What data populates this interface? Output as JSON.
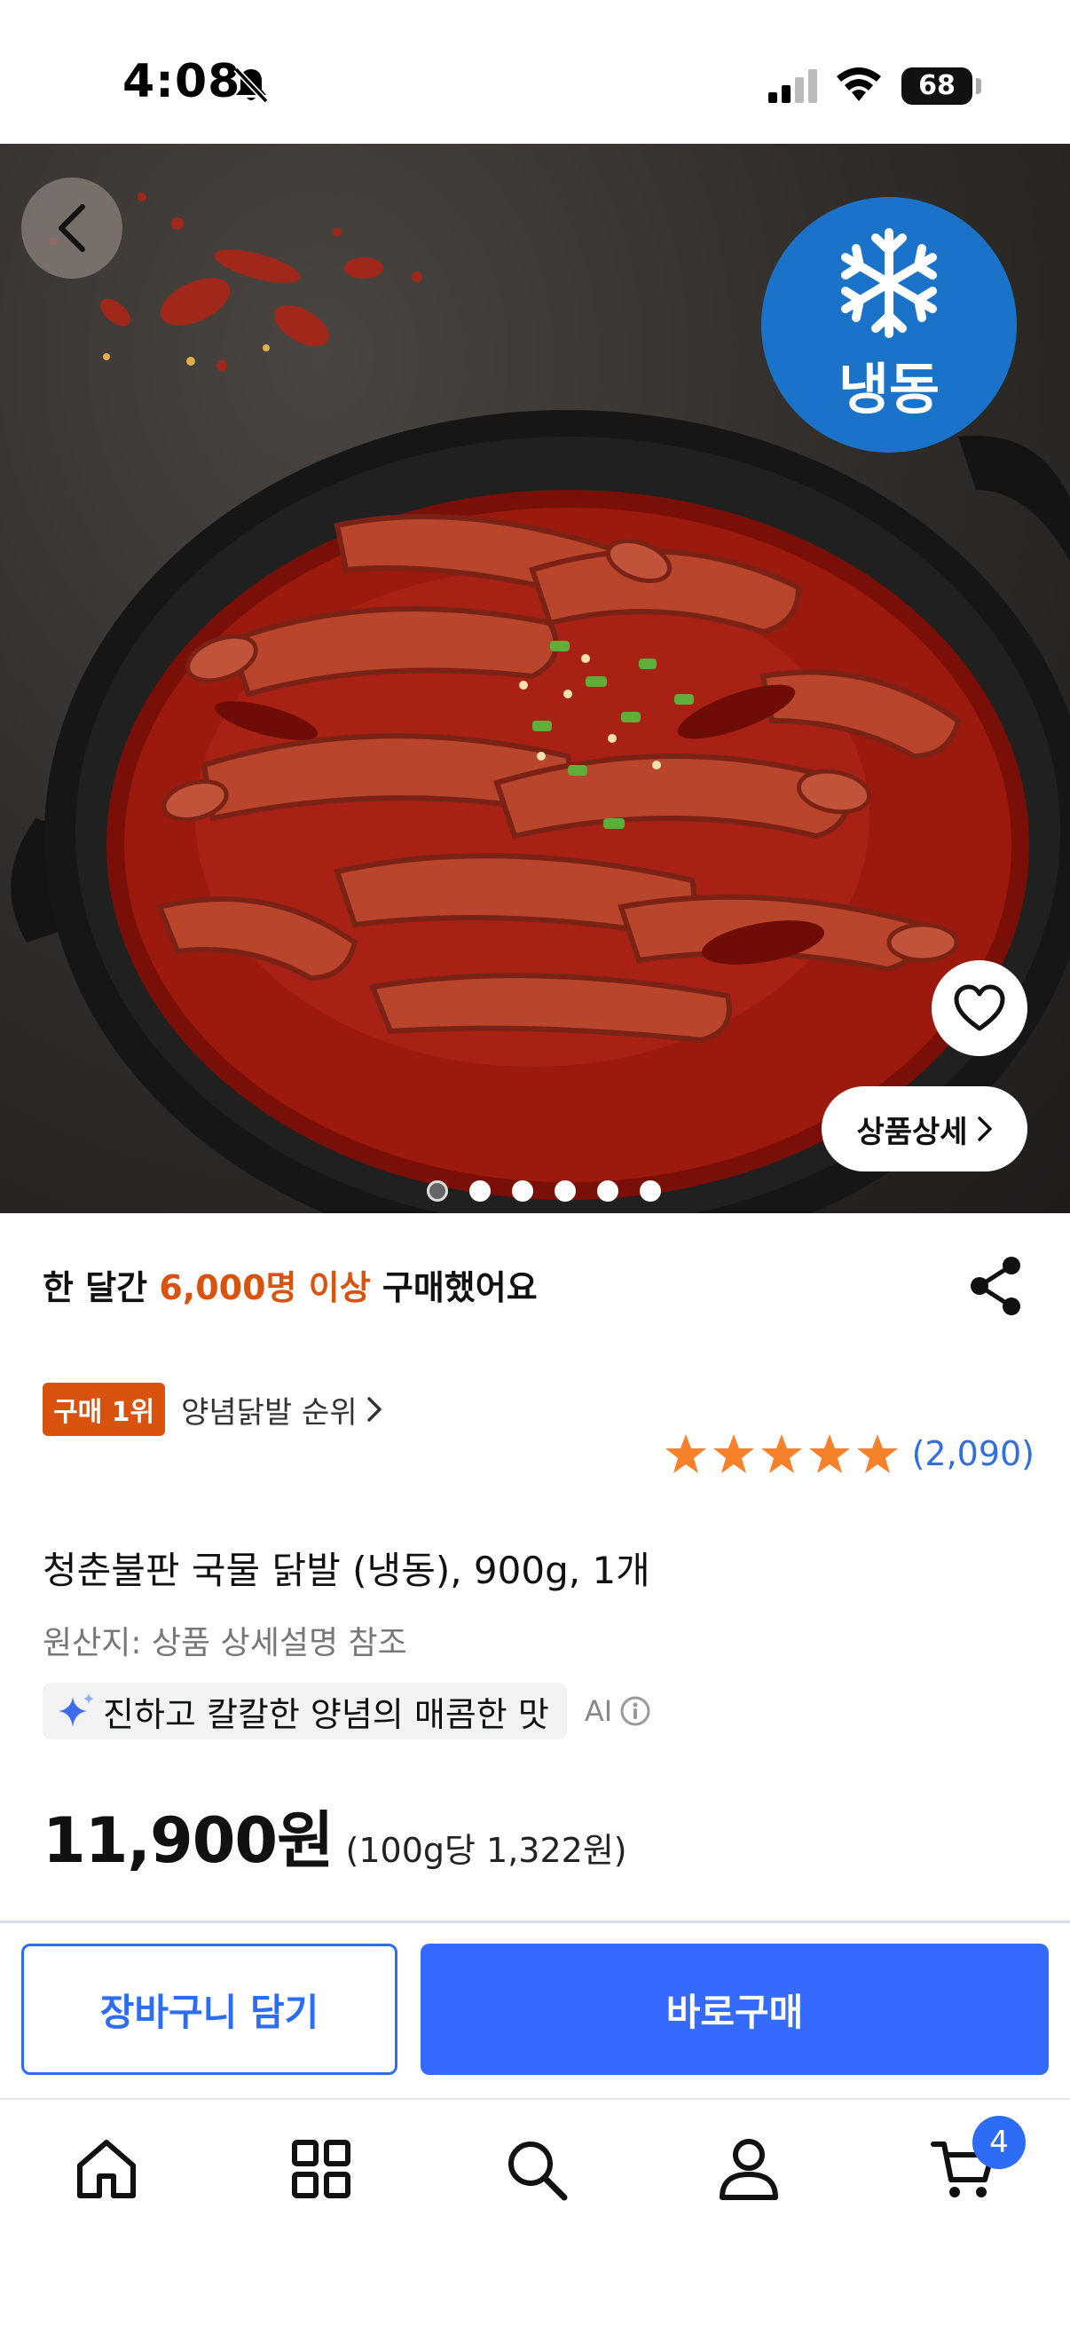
{
  "status_bar": {
    "time": "4:08",
    "battery": "68",
    "battery_level": 0.68
  },
  "hero": {
    "frozen_badge": "냉동",
    "detail_button": "상품상세",
    "image_count": 6,
    "active_image": 1
  },
  "purchase": {
    "prefix": "한 달간 ",
    "highlight": "6,000명 이상",
    "suffix": " 구매했어요"
  },
  "rank": {
    "badge": "구매 1위",
    "link": "양념닭발 순위"
  },
  "rating": {
    "stars": 5,
    "count": "(2,090)"
  },
  "product": {
    "title": "청춘불판 국물 닭발 (냉동), 900g, 1개",
    "origin": "원산지: 상품 상세설명 참조",
    "ai_summary": "진하고 칼칼한 양념의 매콤한 맛",
    "ai_label": "AI",
    "price": "11,900원",
    "unit_price": "(100g당 1,322원)"
  },
  "actions": {
    "cart": "장바구니 담기",
    "buy": "바로구매"
  },
  "nav": {
    "cart_badge": "4"
  },
  "colors": {
    "accent_blue": "#346aff",
    "highlight_orange": "#d9530f",
    "star_orange": "#f5822a",
    "frozen_blue": "#1a73c9"
  }
}
